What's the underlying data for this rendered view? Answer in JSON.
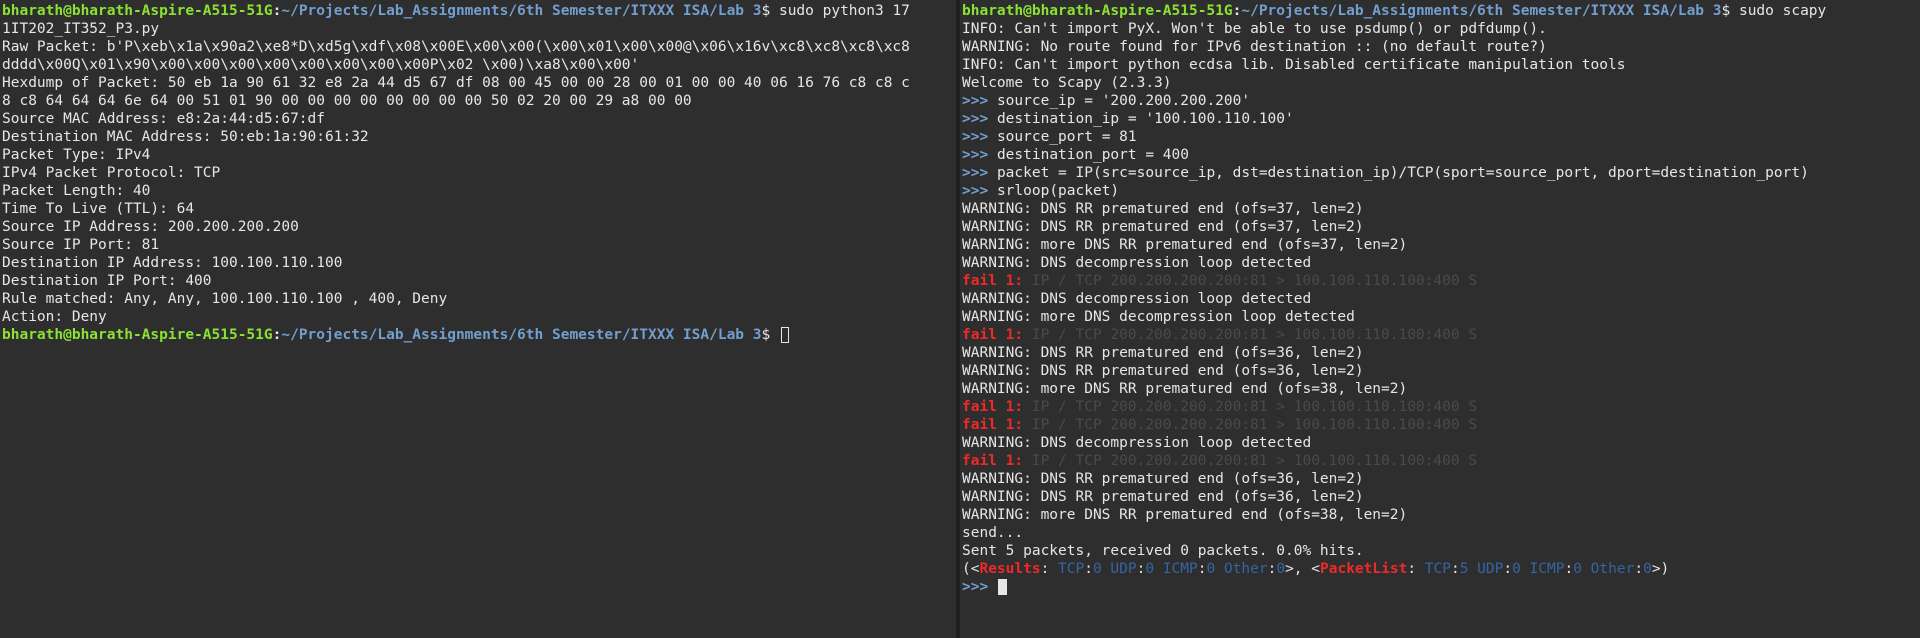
{
  "left": {
    "prompt_user": "bharath@bharath-Aspire-A515-51G",
    "prompt_path": "~/Projects/Lab_Assignments/6th Semester/ITXXX ISA/Lab 3",
    "command_start": "$ sudo python3 17",
    "output_lines": [
      "1IT202_IT352_P3.py",
      "Raw Packet: b'P\\xeb\\x1a\\x90a2\\xe8*D\\xd5g\\xdf\\x08\\x00E\\x00\\x00(\\x00\\x01\\x00\\x00@\\x06\\x16v\\xc8\\xc8\\xc8\\xc8",
      "dddd\\x00Q\\x01\\x90\\x00\\x00\\x00\\x00\\x00\\x00\\x00\\x00P\\x02 \\x00)\\xa8\\x00\\x00'",
      "Hexdump of Packet: 50 eb 1a 90 61 32 e8 2a 44 d5 67 df 08 00 45 00 00 28 00 01 00 00 40 06 16 76 c8 c8 c",
      "8 c8 64 64 64 6e 64 00 51 01 90 00 00 00 00 00 00 00 00 50 02 20 00 29 a8 00 00",
      "Source MAC Address: e8:2a:44:d5:67:df",
      "Destination MAC Address: 50:eb:1a:90:61:32",
      "Packet Type: IPv4",
      "IPv4 Packet Protocol: TCP",
      "Packet Length: 40",
      "Time To Live (TTL): 64",
      "Source IP Address: 200.200.200.200",
      "Source IP Port: 81",
      "Destination IP Address: 100.100.110.100",
      "Destination IP Port: 400",
      "Rule matched: Any, Any, 100.100.110.100 , 400, Deny",
      "Action: Deny"
    ],
    "final_dollar": "$ "
  },
  "right": {
    "prompt_user": "bharath@bharath-Aspire-A515-51G",
    "prompt_path": "~/Projects/Lab_Assignments/6th Semester/ITXXX ISA/Lab 3",
    "command": "$ sudo scapy",
    "lines": [
      {
        "k": "t",
        "text": "INFO: Can't import PyX. Won't be able to use psdump() or pdfdump()."
      },
      {
        "k": "t",
        "text": "WARNING: No route found for IPv6 destination :: (no default route?)"
      },
      {
        "k": "t",
        "text": "INFO: Can't import python ecdsa lib. Disabled certificate manipulation tools"
      },
      {
        "k": "t",
        "text": "Welcome to Scapy (2.3.3)"
      },
      {
        "k": "p",
        "text": "source_ip = '200.200.200.200'"
      },
      {
        "k": "p",
        "text": "destination_ip = '100.100.110.100'"
      },
      {
        "k": "p",
        "text": "source_port = 81"
      },
      {
        "k": "p",
        "text": "destination_port = 400"
      },
      {
        "k": "p",
        "text": "packet = IP(src=source_ip, dst=destination_ip)/TCP(sport=source_port, dport=destination_port)"
      },
      {
        "k": "p",
        "text": "srloop(packet)"
      },
      {
        "k": "t",
        "text": "WARNING: DNS RR prematured end (ofs=37, len=2)"
      },
      {
        "k": "t",
        "text": "WARNING: DNS RR prematured end (ofs=37, len=2)"
      },
      {
        "k": "t",
        "text": "WARNING: more DNS RR prematured end (ofs=37, len=2)"
      },
      {
        "k": "t",
        "text": "WARNING: DNS decompression loop detected"
      },
      {
        "k": "f",
        "text": "IP / TCP 200.200.200.200:81 > 100.100.110.100:400 S"
      },
      {
        "k": "t",
        "text": "WARNING: DNS decompression loop detected"
      },
      {
        "k": "t",
        "text": "WARNING: more DNS decompression loop detected"
      },
      {
        "k": "f",
        "text": "IP / TCP 200.200.200.200:81 > 100.100.110.100:400 S"
      },
      {
        "k": "t",
        "text": "WARNING: DNS RR prematured end (ofs=36, len=2)"
      },
      {
        "k": "t",
        "text": "WARNING: DNS RR prematured end (ofs=36, len=2)"
      },
      {
        "k": "t",
        "text": "WARNING: more DNS RR prematured end (ofs=38, len=2)"
      },
      {
        "k": "f",
        "text": "IP / TCP 200.200.200.200:81 > 100.100.110.100:400 S"
      },
      {
        "k": "f",
        "text": "IP / TCP 200.200.200.200:81 > 100.100.110.100:400 S"
      },
      {
        "k": "t",
        "text": "WARNING: DNS decompression loop detected"
      },
      {
        "k": "f",
        "text": "IP / TCP 200.200.200.200:81 > 100.100.110.100:400 S"
      },
      {
        "k": "t",
        "text": "WARNING: DNS RR prematured end (ofs=36, len=2)"
      },
      {
        "k": "t",
        "text": "WARNING: DNS RR prematured end (ofs=36, len=2)"
      },
      {
        "k": "t",
        "text": "WARNING: more DNS RR prematured end (ofs=38, len=2)"
      },
      {
        "k": "t",
        "text": "send..."
      },
      {
        "k": "t",
        "text": "Sent 5 packets, received 0 packets. 0.0% hits."
      }
    ],
    "fail_label": "fail 1:",
    "prompt_marker": ">>>",
    "results": {
      "results_name": "Results",
      "packetlist_name": "PacketList",
      "results_counts": {
        "TCP": "0",
        "UDP": "0",
        "ICMP": "0",
        "Other": "0"
      },
      "packetlist_counts": {
        "TCP": "5",
        "UDP": "0",
        "ICMP": "0",
        "Other": "0"
      }
    }
  },
  "colors": {
    "background": "#2e2e2e",
    "user": "#8ae234",
    "path": "#729fcf",
    "fail": "#ef2929",
    "dim": "#4a4a4a"
  }
}
